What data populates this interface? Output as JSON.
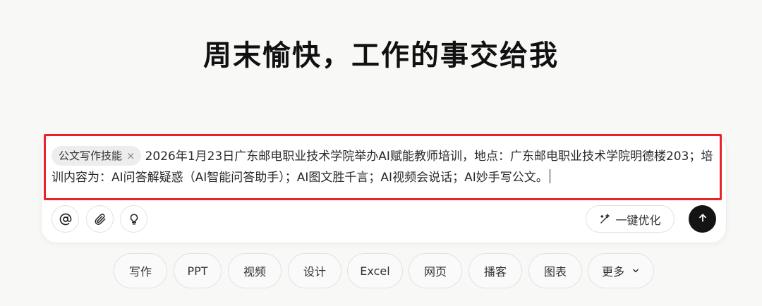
{
  "headline": "周末愉快，工作的事交给我",
  "composer": {
    "skill_chip": "公文写作技能",
    "chip_remove": "×",
    "text": "2026年1月23日广东邮电职业技术学院举办AI赋能教师培训，地点：广东邮电职业技术学院明德楼203；培训内容为：AI问答解疑惑（AI智能问答助手）；AI图文胜千言；AI视频会说话；AI妙手写公文。",
    "tools": [
      "at-icon",
      "paperclip-icon",
      "lightbulb-icon"
    ],
    "optimize_label": "一键优化",
    "optimize_icon": "magic-pen-icon",
    "send_icon": "arrow-up-icon"
  },
  "highlight_color": "#e8232a",
  "quick_actions": [
    "写作",
    "PPT",
    "视频",
    "设计",
    "Excel",
    "网页",
    "播客",
    "图表",
    "更多"
  ]
}
